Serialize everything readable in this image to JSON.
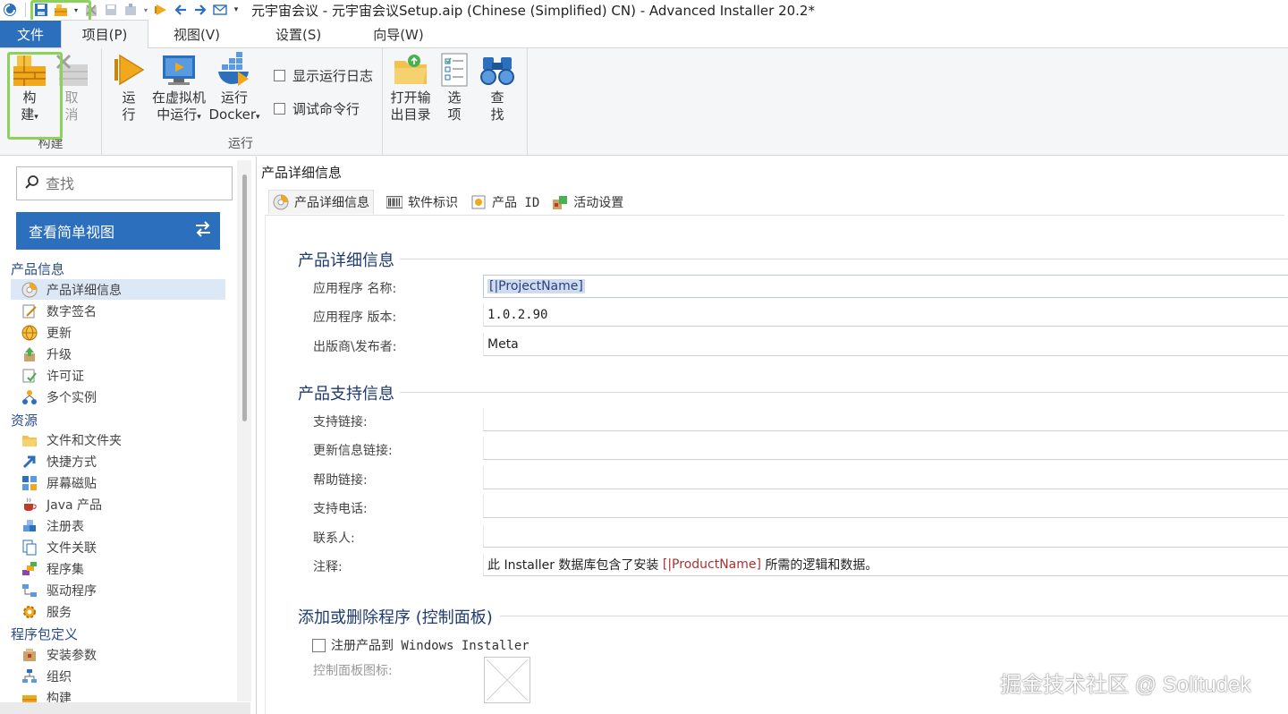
{
  "window": {
    "title": "元宇宙会议 - 元宇宙会议Setup.aip (Chinese (Simplified) CN) - Advanced Installer 20.2*"
  },
  "ribbon_tabs": [
    "文件",
    "项目(P)",
    "视图(V)",
    "设置(S)",
    "向导(W)"
  ],
  "ribbon": {
    "build_group": {
      "label": "构建",
      "build_btn": {
        "line1": "构",
        "line2": "建"
      },
      "cancel_btn": {
        "line1": "取",
        "line2": "消"
      }
    },
    "run_group": {
      "label": "运行",
      "run_btn": {
        "line1": "运",
        "line2": "行"
      },
      "vm_btn": {
        "line1": "在虚拟机",
        "line2": "中运行"
      },
      "docker_btn": {
        "line1": "运行",
        "line2": "Docker"
      },
      "show_log": "显示运行日志",
      "debug_cmd": "调试命令行"
    },
    "other_group": {
      "open_output": {
        "line1": "打开输",
        "line2": "出目录"
      },
      "options": {
        "line1": "选",
        "line2": "项"
      },
      "find": {
        "line1": "查",
        "line2": "找"
      }
    }
  },
  "left": {
    "search_placeholder": "查找",
    "simple_view_label": "查看简单视图",
    "categories": {
      "product_info": "产品信息",
      "resources": "资源",
      "package_def": "程序包定义"
    },
    "product_info_items": [
      "产品详细信息",
      "数字签名",
      "更新",
      "升级",
      "许可证",
      "多个实例"
    ],
    "resources_items": [
      "文件和文件夹",
      "快捷方式",
      "屏幕磁贴",
      "Java 产品",
      "注册表",
      "文件关联",
      "程序集",
      "驱动程序",
      "服务"
    ],
    "package_def_items": [
      "安装参数",
      "组织",
      "构建"
    ]
  },
  "right": {
    "panel_title": "产品详细信息",
    "tabs": [
      "产品详细信息",
      "软件标识",
      "产品 ID",
      "活动设置"
    ],
    "section_details": {
      "title": "产品详细信息",
      "fields": [
        {
          "label": "应用程序 名称:",
          "value": "[|ProjectName]"
        },
        {
          "label": "应用程序 版本:",
          "value": "1.0.2.90"
        },
        {
          "label": "出版商\\发布者:",
          "value": "Meta"
        }
      ]
    },
    "section_support": {
      "title": "产品支持信息",
      "fields": [
        {
          "label": "支持链接:",
          "value": ""
        },
        {
          "label": "更新信息链接:",
          "value": ""
        },
        {
          "label": "帮助链接:",
          "value": ""
        },
        {
          "label": "支持电话:",
          "value": ""
        },
        {
          "label": "联系人:",
          "value": ""
        }
      ],
      "comment_label": "注释:",
      "comment_prefix": "此 Installer 数据库包含了安装 ",
      "comment_var": "[|ProductName]",
      "comment_suffix": " 所需的逻辑和数据。"
    },
    "section_arp": {
      "title": "添加或删除程序 (控制面板)",
      "register_label": "注册产品到 Windows Installer",
      "cp_icon_label": "控制面板图标:"
    }
  },
  "watermark": "掘金技术社区 @ Solitudek"
}
